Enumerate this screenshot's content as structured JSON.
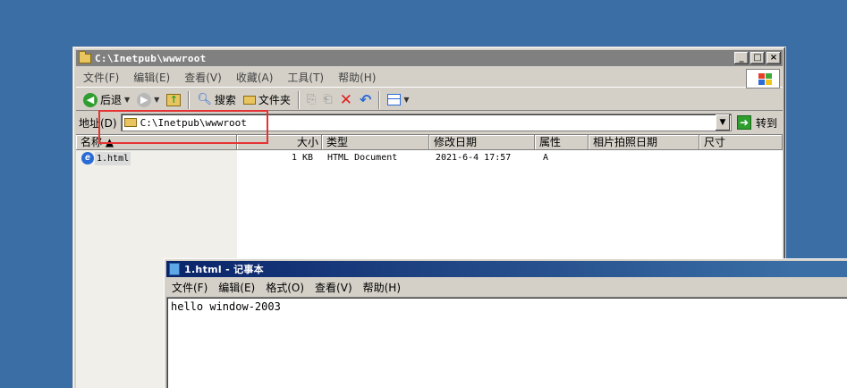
{
  "explorer": {
    "title": "C:\\Inetpub\\wwwroot",
    "menu": [
      "文件(F)",
      "编辑(E)",
      "查看(V)",
      "收藏(A)",
      "工具(T)",
      "帮助(H)"
    ],
    "toolbar": {
      "back": "后退",
      "search": "搜索",
      "folders": "文件夹"
    },
    "address": {
      "label": "地址(D)",
      "value": "C:\\Inetpub\\wwwroot",
      "go": "转到"
    },
    "columns": [
      "名称 ▲",
      "大小",
      "类型",
      "修改日期",
      "属性",
      "相片拍照日期",
      "尺寸"
    ],
    "files": [
      {
        "name": "1.html",
        "size": "1 KB",
        "type": "HTML Document",
        "modified": "2021-6-4 17:57",
        "attr": "A"
      }
    ]
  },
  "notepad": {
    "title": "1.html - 记事本",
    "menu": [
      "文件(F)",
      "编辑(E)",
      "格式(O)",
      "查看(V)",
      "帮助(H)"
    ],
    "content": "hello window-2003"
  },
  "colors": {
    "desktop": "#3a6ea5",
    "highlight": "#e53333",
    "active_title": "#0a246a"
  }
}
